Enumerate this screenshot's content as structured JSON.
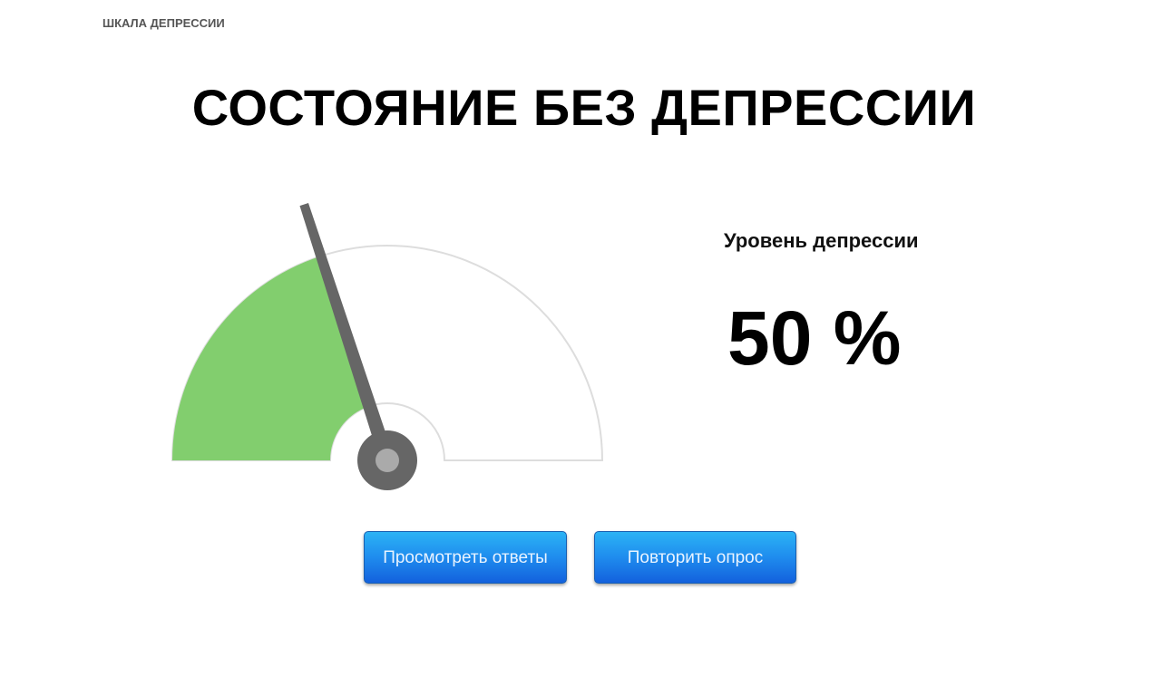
{
  "header": {
    "scale_label": "ШКАЛА ДЕПРЕССИИ"
  },
  "result": {
    "title": "СОСТОЯНИЕ БЕЗ ДЕПРЕССИИ"
  },
  "level": {
    "label": "Уровень депрессии",
    "value": "50 %"
  },
  "gauge": {
    "needle_fraction": 0.4,
    "fill_color": "#82ce6e",
    "needle_color": "#666666",
    "hub_color": "#aaaaaa",
    "track_color": "#dddddd"
  },
  "buttons": {
    "view_answers": "Просмотреть ответы",
    "retake": "Повторить опрос"
  }
}
